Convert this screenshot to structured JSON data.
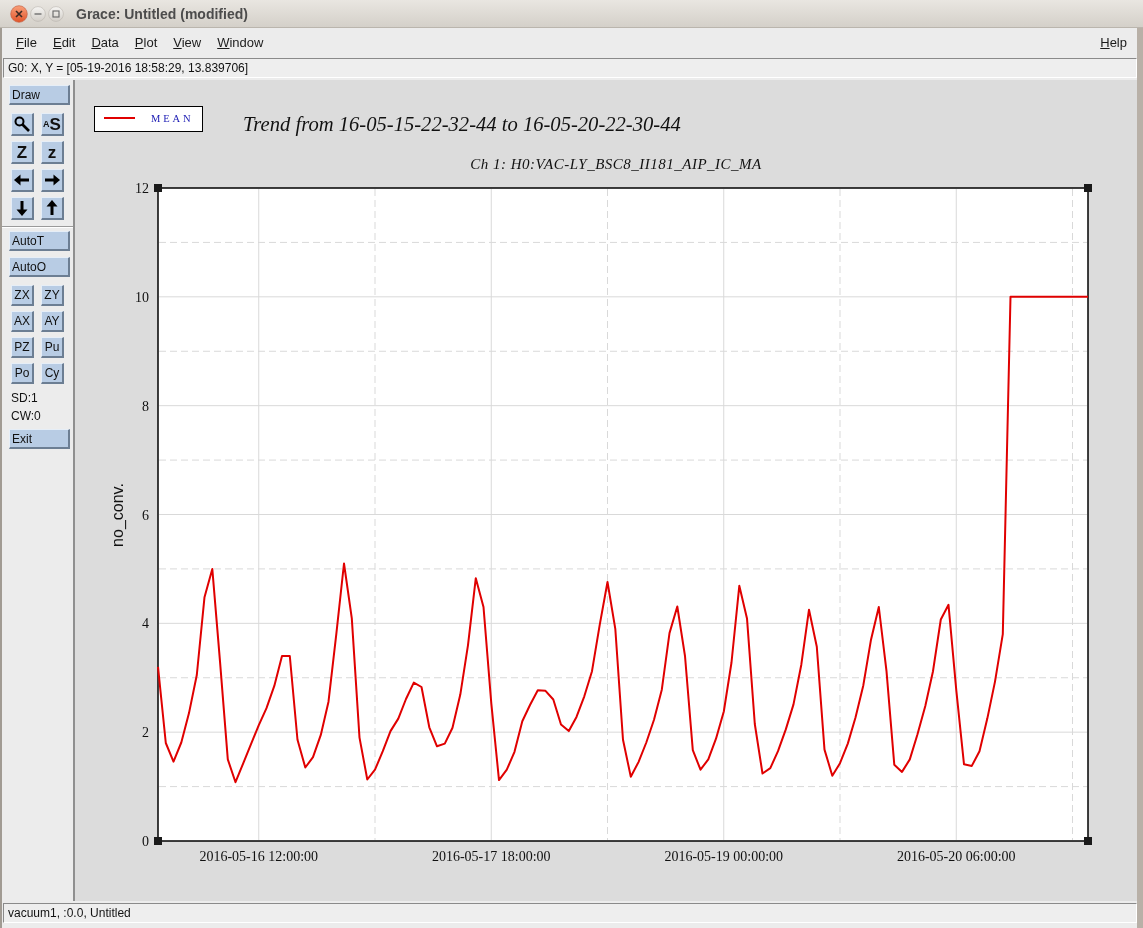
{
  "window": {
    "title": "Grace: Untitled (modified)"
  },
  "menu": [
    "File",
    "Edit",
    "Data",
    "Plot",
    "View",
    "Window"
  ],
  "help_menu": "Help",
  "coordinate_readout": "G0: X, Y = [05-19-2016 18:58:29, 13.839706]",
  "toolbar": {
    "draw_button": "Draw",
    "tool_buttons": [
      {
        "kind": "icon"
      },
      {
        "kind": "glyph",
        "label": "$^{A}$S"
      },
      {
        "kind": "glyph",
        "label": "Z"
      },
      {
        "kind": "glyph",
        "label": "z"
      },
      {
        "kind": "icon"
      },
      {
        "kind": "icon"
      },
      {
        "kind": "icon"
      },
      {
        "kind": "icon"
      }
    ],
    "auto_buttons": [
      "AutoT",
      "AutoO"
    ],
    "view_buttons": [
      "ZX",
      "ZY",
      "AX",
      "AY",
      "PZ",
      "Pu",
      "Po",
      "Cy"
    ],
    "readouts": [
      "SD:1",
      "CW:0"
    ],
    "exit_button": "Exit"
  },
  "plot": {
    "subtitle": "Ch 1: H0:VAC-LY_BSC8_II181_AIP_IC_MA",
    "chart_data": {
      "type": "line",
      "title": "Trend from 16-05-15-22-32-44 to 16-05-20-22-30-44",
      "ylabel": "no_conv.",
      "grid": true,
      "categories": [
        null,
        null,
        null,
        null,
        null,
        null,
        null,
        null,
        null,
        null,
        null,
        null,
        null,
        "2016-05-16 12:00:00",
        null,
        null,
        null,
        null,
        null,
        null,
        null,
        null,
        null,
        null,
        null,
        null,
        null,
        null,
        null,
        null,
        null,
        null,
        null,
        null,
        null,
        null,
        null,
        null,
        null,
        null,
        null,
        null,
        null,
        "2016-05-17 18:00:00",
        null,
        null,
        null,
        null,
        null,
        null,
        null,
        null,
        null,
        null,
        null,
        null,
        null,
        null,
        null,
        null,
        null,
        null,
        null,
        null,
        null,
        null,
        null,
        null,
        null,
        null,
        null,
        null,
        null,
        "2016-05-19 00:00:00",
        null,
        null,
        null,
        null,
        null,
        null,
        null,
        null,
        null,
        null,
        null,
        null,
        null,
        null,
        null,
        null,
        null,
        null,
        null,
        null,
        null,
        null,
        null,
        null,
        null,
        null,
        null,
        null,
        null,
        "2016-05-20 06:00:00",
        null,
        null,
        null,
        null,
        null,
        null,
        null,
        null,
        null,
        null,
        null,
        null,
        null,
        null,
        null,
        null,
        null
      ],
      "series": [
        {
          "name": "MEAN",
          "color": "#e00000",
          "values": [
            3.2,
            1.8,
            1.46,
            1.81,
            2.35,
            3.05,
            4.48,
            5.0,
            3.3,
            1.5,
            1.08,
            1.43,
            1.78,
            2.13,
            2.44,
            2.85,
            3.4,
            3.4,
            1.86,
            1.35,
            1.54,
            1.95,
            2.56,
            3.8,
            5.1,
            4.09,
            1.9,
            1.13,
            1.31,
            1.65,
            2.02,
            2.25,
            2.61,
            2.91,
            2.83,
            2.09,
            1.74,
            1.79,
            2.08,
            2.69,
            3.6,
            4.83,
            4.3,
            2.53,
            1.12,
            1.31,
            1.64,
            2.2,
            2.5,
            2.77,
            2.76,
            2.6,
            2.14,
            2.02,
            2.28,
            2.66,
            3.12,
            3.98,
            4.76,
            3.9,
            1.86,
            1.18,
            1.45,
            1.81,
            2.23,
            2.78,
            3.82,
            4.31,
            3.4,
            1.67,
            1.31,
            1.5,
            1.88,
            2.38,
            3.28,
            4.69,
            4.09,
            2.15,
            1.24,
            1.34,
            1.65,
            2.05,
            2.51,
            3.24,
            4.25,
            3.57,
            1.68,
            1.2,
            1.43,
            1.79,
            2.27,
            2.86,
            3.7,
            4.3,
            3.12,
            1.4,
            1.27,
            1.5,
            1.96,
            2.48,
            3.12,
            4.07,
            4.34,
            2.77,
            1.41,
            1.38,
            1.65,
            2.25,
            2.93,
            3.8,
            10.0,
            10.0,
            10.0,
            10.0,
            10.0,
            10.0,
            10.0,
            10.0,
            10.0,
            10.0,
            10.0
          ]
        }
      ],
      "ylim": [
        0,
        12
      ],
      "yticks": [
        0,
        2,
        4,
        6,
        8,
        10,
        12
      ]
    }
  },
  "status_bar": "vacuum1, :0.0, Untitled"
}
